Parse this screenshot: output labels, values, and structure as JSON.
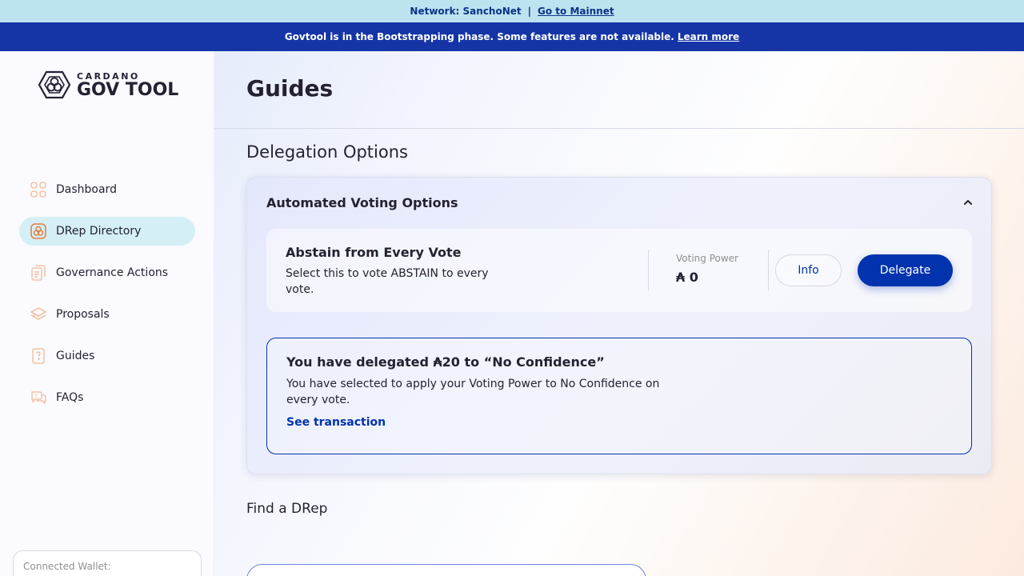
{
  "network_bar": {
    "label": "Network: SanchoNet",
    "separator": "|",
    "link": "Go to Mainnet"
  },
  "banner": {
    "text": "Govtool is in the Bootstrapping phase. Some features are not available.",
    "link": "Learn more"
  },
  "logo": {
    "small": "CARDANO",
    "big": "GOV TOOL"
  },
  "sidebar": {
    "items": [
      {
        "label": "Dashboard",
        "icon": "dashboard-icon"
      },
      {
        "label": "DRep Directory",
        "icon": "drep-directory-icon"
      },
      {
        "label": "Governance Actions",
        "icon": "governance-actions-icon"
      },
      {
        "label": "Proposals",
        "icon": "proposals-icon"
      },
      {
        "label": "Guides",
        "icon": "guides-icon"
      },
      {
        "label": "FAQs",
        "icon": "faqs-icon"
      }
    ],
    "wallet_label": "Connected Wallet:"
  },
  "page": {
    "title": "Guides",
    "section_title": "Delegation Options"
  },
  "accordion": {
    "title": "Automated Voting Options"
  },
  "option": {
    "title": "Abstain from Every Vote",
    "description": "Select this to vote ABSTAIN to every vote.",
    "voting_power_label": "Voting Power",
    "voting_power_value": "₳ 0",
    "info_label": "Info",
    "delegate_label": "Delegate"
  },
  "delegated": {
    "title": "You have delegated ₳20 to “No Confidence”",
    "description": "You have selected to apply your Voting Power to No Confidence on every vote.",
    "link": "See transaction"
  },
  "find": {
    "title": "Find a DRep"
  },
  "colors": {
    "primary": "#0033ad",
    "accent_orange": "#e37f47",
    "banner": "#1535a7",
    "network_bar": "#bde3f0"
  }
}
